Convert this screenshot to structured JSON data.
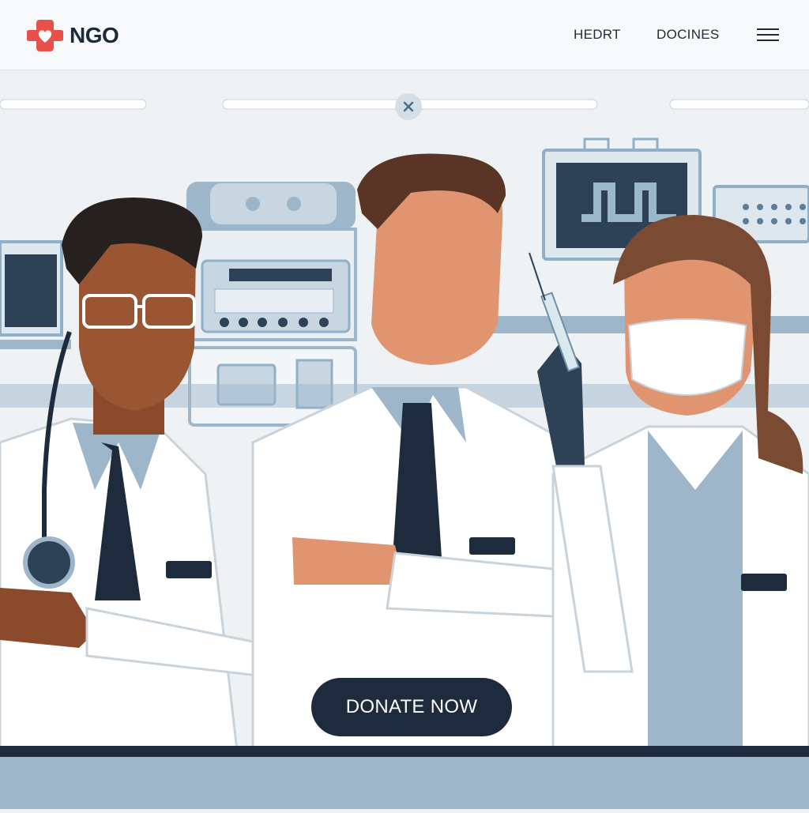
{
  "brand": {
    "name": "NGO",
    "accent": "#e8504a"
  },
  "nav": {
    "items": [
      {
        "label": "HEDRT"
      },
      {
        "label": "DOCINES"
      }
    ]
  },
  "menu_icon": "hamburger-menu-icon",
  "hero": {
    "carousel_close_icon": "close-icon"
  },
  "cta": {
    "label": "DONATE NOW"
  },
  "colors": {
    "navy": "#1d2b3c",
    "light_blue": "#9db6c9",
    "coat": "#ffffff"
  }
}
